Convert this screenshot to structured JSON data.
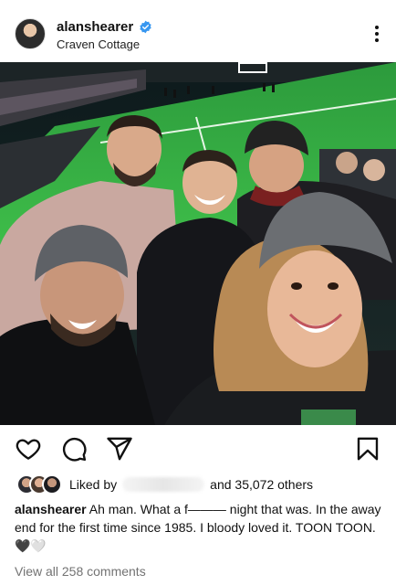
{
  "post": {
    "username": "alanshearer",
    "location": "Craven Cottage",
    "verified_color": "#3897f0"
  },
  "actions": {
    "like_icon": "heart-icon",
    "comment_icon": "comment-icon",
    "share_icon": "send-icon",
    "save_icon": "bookmark-icon"
  },
  "likes": {
    "liked_by": "Liked by",
    "others": "and 35,072 others"
  },
  "caption": {
    "username": "alanshearer",
    "text": "Ah man. What a f——— night that was. In the away end for the first time since 1985. I bloody loved it. TOON TOON. 🖤🤍"
  },
  "comments": {
    "view_all": "View all 258 comments"
  }
}
